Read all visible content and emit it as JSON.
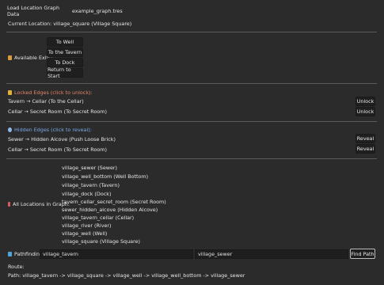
{
  "header": {
    "load_button": "Load Location Graph Data",
    "file_name": "example_graph.tres",
    "current_location": "Current Location: village_square (Village Square)"
  },
  "exits": {
    "label": "Available Exits:",
    "buttons": [
      "To Well",
      "To the Tavern",
      "To Dock",
      "Return to Start"
    ]
  },
  "locked": {
    "title": "Locked Edges (click to unlock):",
    "edges": [
      {
        "text": "Tavern → Cellar (To the Cellar)",
        "action": "Unlock"
      },
      {
        "text": "Cellar → Secret Room (To Secret Room)",
        "action": "Unlock"
      }
    ]
  },
  "hidden": {
    "title": "Hidden Edges (click to reveal):",
    "edges": [
      {
        "text": "Sewer → Hidden Alcove (Push Loose Brick)",
        "action": "Reveal"
      },
      {
        "text": "Cellar → Secret Room (To Secret Room)",
        "action": "Reveal"
      }
    ]
  },
  "locations": {
    "label": "All Locations in Graph:",
    "items": [
      "village_sewer (Sewer)",
      "village_well_bottom (Well Bottom)",
      "village_tavern (Tavern)",
      "village_dock (Dock)",
      "tavern_cellar_secret_room (Secret Room)",
      "sewer_hidden_alcove (Hidden Alcove)",
      "village_tavern_cellar (Cellar)",
      "village_river (River)",
      "village_well (Well)",
      "village_square (Village Square)"
    ]
  },
  "pathfinding": {
    "label": "Pathfinding:",
    "from_value": "village_tavern",
    "to_value": "village_sewer",
    "button": "Find Path",
    "route_label": "Route:",
    "path_text": "Path: village_tavern -> village_square -> village_well -> village_well_bottom -> village_sewer"
  },
  "colors": {
    "locked_title": "#e8846b",
    "hidden_title": "#79a9e6",
    "exits_icon": "#d79a3e",
    "lock_icon": "#e0b23a",
    "eye_icon": "#8fb8e8",
    "pin_icon": "#d85a5a",
    "path_icon": "#4fa3d9"
  }
}
